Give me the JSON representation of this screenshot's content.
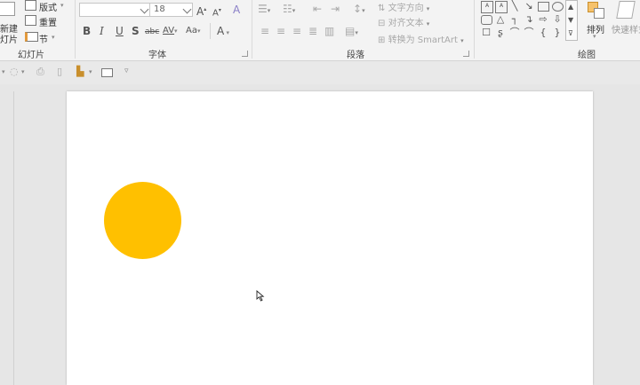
{
  "ribbon": {
    "slides_group": {
      "label": "幻灯片",
      "new_slide_line1": "新建",
      "new_slide_line2": "灯片",
      "layout": "版式",
      "reset": "重置",
      "section": "节"
    },
    "font_group": {
      "label": "字体",
      "font_name": "",
      "font_size": "18",
      "grow_font": "A",
      "shrink_font": "A",
      "bold": "B",
      "italic": "I",
      "underline": "U",
      "shadow": "S",
      "strike": "abc",
      "spacing": "AV",
      "case": "Aa",
      "font_color": "A"
    },
    "paragraph_group": {
      "label": "段落",
      "text_direction": "文字方向",
      "align_text": "对齐文本",
      "smartart": "转换为 SmartArt"
    },
    "drawing_group": {
      "label": "绘图",
      "arrange": "排列",
      "quick_styles": "快速样式"
    }
  },
  "slide": {
    "circle_color": "#ffc000"
  },
  "colors": {
    "ribbon_bg": "#f3f3f3",
    "canvas_bg": "#e6e6e6",
    "slide_bg": "#ffffff",
    "accent": "#ffc000"
  }
}
